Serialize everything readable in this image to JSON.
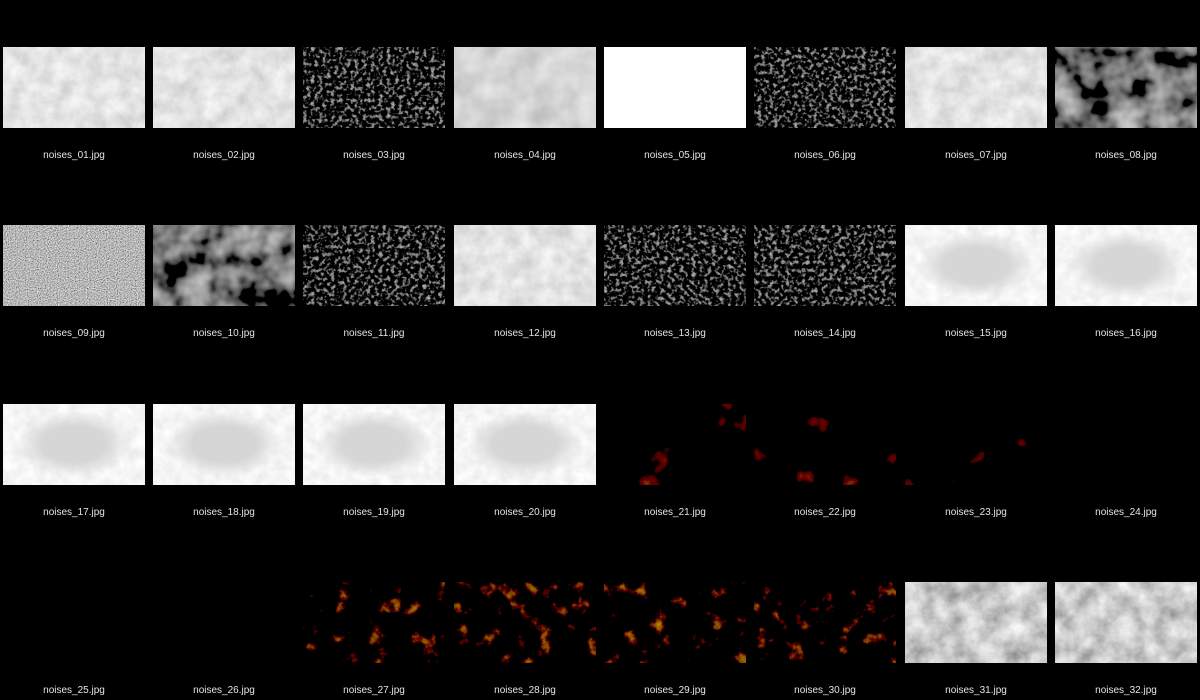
{
  "files": [
    {
      "name": "noises_01.jpg",
      "style": "silver-crumple"
    },
    {
      "name": "noises_02.jpg",
      "style": "silver-crumple"
    },
    {
      "name": "noises_03.jpg",
      "style": "dark-grain"
    },
    {
      "name": "noises_04.jpg",
      "style": "silver-ripple"
    },
    {
      "name": "noises_05.jpg",
      "style": "silver-smooth"
    },
    {
      "name": "noises_06.jpg",
      "style": "dark-grain"
    },
    {
      "name": "noises_07.jpg",
      "style": "silver-crumple"
    },
    {
      "name": "noises_08.jpg",
      "style": "dark-swirl"
    },
    {
      "name": "noises_09.jpg",
      "style": "static"
    },
    {
      "name": "noises_10.jpg",
      "style": "dark-swirl"
    },
    {
      "name": "noises_11.jpg",
      "style": "dark-grain"
    },
    {
      "name": "noises_12.jpg",
      "style": "silver-crumple"
    },
    {
      "name": "noises_13.jpg",
      "style": "dark-grain"
    },
    {
      "name": "noises_14.jpg",
      "style": "dark-grain"
    },
    {
      "name": "noises_15.jpg",
      "style": "silver-frame"
    },
    {
      "name": "noises_16.jpg",
      "style": "silver-frame"
    },
    {
      "name": "noises_17.jpg",
      "style": "silver-frame"
    },
    {
      "name": "noises_18.jpg",
      "style": "silver-frame"
    },
    {
      "name": "noises_19.jpg",
      "style": "silver-frame"
    },
    {
      "name": "noises_20.jpg",
      "style": "silver-frame"
    },
    {
      "name": "noises_21.jpg",
      "style": "black-gold"
    },
    {
      "name": "noises_22.jpg",
      "style": "black-gold"
    },
    {
      "name": "noises_23.jpg",
      "style": "black-gold"
    },
    {
      "name": "noises_24.jpg",
      "style": "black-swirl"
    },
    {
      "name": "noises_25.jpg",
      "style": "black-swirl"
    },
    {
      "name": "noises_26.jpg",
      "style": "black-swirl"
    },
    {
      "name": "noises_27.jpg",
      "style": "rock-gold"
    },
    {
      "name": "noises_28.jpg",
      "style": "rock-gold"
    },
    {
      "name": "noises_29.jpg",
      "style": "rock-gold"
    },
    {
      "name": "noises_30.jpg",
      "style": "rock-gold"
    },
    {
      "name": "noises_31.jpg",
      "style": "silver-rock"
    },
    {
      "name": "noises_32.jpg",
      "style": "silver-rock"
    }
  ],
  "styles": {
    "silver-crumple": {
      "base": "#b8b8b8",
      "freq": 0.06,
      "oct": 4,
      "contrast": 1.6,
      "bright": 0.05,
      "light": "#ffffff"
    },
    "silver-ripple": {
      "base": "#a9a9a9",
      "freq": 0.04,
      "oct": 3,
      "contrast": 1.4,
      "bright": 0.0,
      "light": "#f0f0f0"
    },
    "silver-smooth": {
      "base": "#c9c9c9",
      "freq": 0.015,
      "oct": 2,
      "contrast": 0.7,
      "bright": 0.25,
      "light": "#ffffff"
    },
    "silver-frame": {
      "base": "#cfcfcf",
      "freq": 0.09,
      "oct": 4,
      "contrast": 1.4,
      "bright": 0.1,
      "light": "#ffffff"
    },
    "silver-rock": {
      "base": "#9a9a9a",
      "freq": 0.05,
      "oct": 5,
      "contrast": 2.2,
      "bright": 0.0,
      "light": "#ffffff"
    },
    "dark-grain": {
      "base": "#3a3a3a",
      "freq": 0.25,
      "oct": 4,
      "contrast": 2.2,
      "bright": -0.25,
      "light": "#d0d0d0"
    },
    "dark-swirl": {
      "base": "#4a4a4a",
      "freq": 0.035,
      "oct": 3,
      "contrast": 2.0,
      "bright": -0.1,
      "light": "#e8e8e8"
    },
    "static": {
      "base": "#7a7a7a",
      "freq": 0.9,
      "oct": 2,
      "contrast": 2.5,
      "bright": 0.0,
      "light": "#ffffff"
    },
    "black-gold": {
      "base": "#0e0e0e",
      "freq": 0.03,
      "oct": 3,
      "contrast": 2.4,
      "bright": -0.45,
      "light": "#d8a020"
    },
    "black-swirl": {
      "base": "#121212",
      "freq": 0.03,
      "oct": 3,
      "contrast": 1.8,
      "bright": -0.45,
      "light": "#4a4a4a"
    },
    "rock-gold": {
      "base": "#1a1a1a",
      "freq": 0.06,
      "oct": 5,
      "contrast": 2.3,
      "bright": -0.3,
      "light": "#c8861e"
    }
  }
}
